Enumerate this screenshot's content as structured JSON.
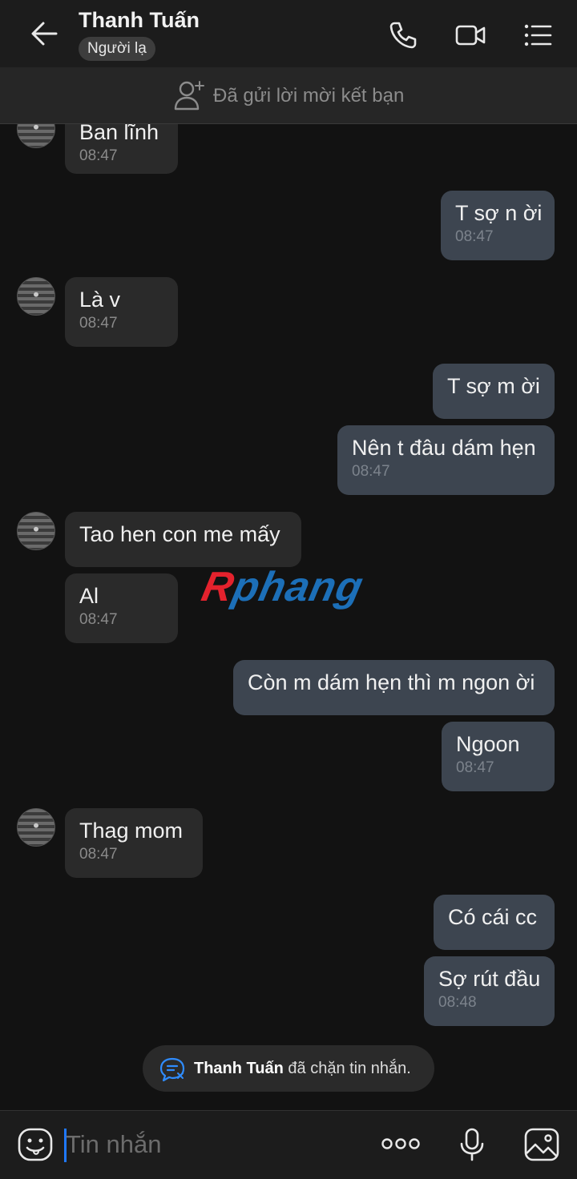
{
  "header": {
    "contact_name": "Thanh Tuấn",
    "badge": "Người lạ"
  },
  "friend_bar": {
    "text": "Đã gửi lời mời kết bạn"
  },
  "messages": [
    {
      "side": "in",
      "text": "Ban lĩnh",
      "time": "08:47"
    },
    {
      "side": "out",
      "text": "T sợ n ời",
      "time": "08:47"
    },
    {
      "side": "in",
      "text": "Là v",
      "time": "08:47"
    },
    {
      "side": "out",
      "text": "T sợ m ời",
      "time": ""
    },
    {
      "side": "out",
      "text": "Nên t đâu dám hẹn",
      "time": "08:47"
    },
    {
      "side": "in",
      "text": "Tao hen con me mấy",
      "time": ""
    },
    {
      "side": "in",
      "text": "Al",
      "time": "08:47"
    },
    {
      "side": "out",
      "text": "Còn m dám hẹn thì m ngon ời",
      "time": ""
    },
    {
      "side": "out",
      "text": "Ngoon",
      "time": "08:47"
    },
    {
      "side": "in",
      "text": "Thag mom",
      "time": "08:47"
    },
    {
      "side": "out",
      "text": "Có cái cc",
      "time": ""
    },
    {
      "side": "out",
      "text": "Sợ rút đầu",
      "time": "08:48"
    }
  ],
  "watermark": {
    "r": "R",
    "rest": "phang"
  },
  "notice": {
    "name": "Thanh Tuấn",
    "text": " đã chặn tin nhắn."
  },
  "input": {
    "placeholder": "Tin nhắn"
  },
  "icons": {
    "back": "back-arrow-icon",
    "call": "phone-icon",
    "video": "video-camera-icon",
    "menu": "list-menu-icon",
    "add_friend": "add-person-icon",
    "emoji": "emoji-icon",
    "more": "more-dots-icon",
    "mic": "microphone-icon",
    "image": "image-icon"
  },
  "colors": {
    "background": "#121212",
    "incoming_bubble": "#2a2a2a",
    "outgoing_bubble": "#3d4550",
    "accent": "#1f78ff"
  }
}
